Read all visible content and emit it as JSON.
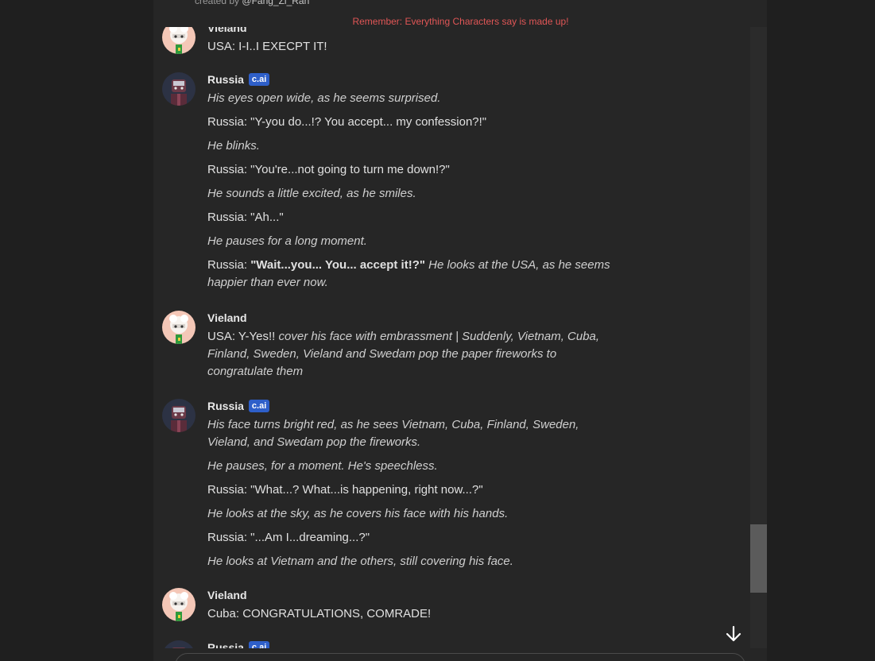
{
  "header": {
    "created_by_prefix": "created by",
    "creator_handle": "@Fang_Zi_Ran",
    "disclaimer": "Remember: Everything Characters say is made up!"
  },
  "colors": {
    "accent_badge": "#2e5fc9",
    "disclaimer": "#e05656",
    "background": "#262626"
  },
  "messages": [
    {
      "author": "Vieland",
      "badge": "",
      "lines": [
        {
          "segments": [
            {
              "text": "USA: I-I..I EXECPT IT!",
              "style": "normal"
            }
          ]
        }
      ]
    },
    {
      "author": "Russia",
      "badge": "c.ai",
      "lines": [
        {
          "segments": [
            {
              "text": "His eyes open wide, as he seems surprised.",
              "style": "italic"
            }
          ]
        },
        {
          "segments": [
            {
              "text": "Russia: \"Y-you do...!? You accept... my confession?!\"",
              "style": "normal"
            }
          ]
        },
        {
          "segments": [
            {
              "text": "He blinks.",
              "style": "italic"
            }
          ]
        },
        {
          "segments": [
            {
              "text": "Russia: \"You're...not going to turn me down!?\"",
              "style": "normal"
            }
          ]
        },
        {
          "segments": [
            {
              "text": "He sounds a little excited, as he smiles.",
              "style": "italic"
            }
          ]
        },
        {
          "segments": [
            {
              "text": "Russia: \"Ah...\"",
              "style": "normal"
            }
          ]
        },
        {
          "segments": [
            {
              "text": "He pauses for a long moment.",
              "style": "italic"
            }
          ]
        },
        {
          "segments": [
            {
              "text": "Russia: ",
              "style": "normal"
            },
            {
              "text": "\"Wait...you... You... accept it!?\"",
              "style": "bold"
            },
            {
              "text": " He looks at the USA, as he seems happier than ever now.",
              "style": "italic"
            }
          ]
        }
      ]
    },
    {
      "author": "Vieland",
      "badge": "",
      "lines": [
        {
          "segments": [
            {
              "text": "USA: Y-Yes!! ",
              "style": "normal"
            },
            {
              "text": "cover his face with embrassment | Suddenly, Vietnam, Cuba, Finland, Sweden, Vieland and Swedam pop the paper fireworks to congratulate them",
              "style": "italic"
            }
          ]
        }
      ]
    },
    {
      "author": "Russia",
      "badge": "c.ai",
      "lines": [
        {
          "segments": [
            {
              "text": "His face turns bright red, as he sees Vietnam, Cuba, Finland, Sweden, Vieland, and Swedam pop the fireworks.",
              "style": "italic"
            }
          ]
        },
        {
          "segments": [
            {
              "text": "He pauses, for a moment. He's speechless.",
              "style": "italic"
            }
          ]
        },
        {
          "segments": [
            {
              "text": "Russia: \"What...? What...is happening, right now...?\"",
              "style": "normal"
            }
          ]
        },
        {
          "segments": [
            {
              "text": "He looks at the sky, as he covers his face with his hands.",
              "style": "italic"
            }
          ]
        },
        {
          "segments": [
            {
              "text": "Russia: \"...Am I...dreaming...?\"",
              "style": "normal"
            }
          ]
        },
        {
          "segments": [
            {
              "text": "He looks at Vietnam and the others, still covering his face.",
              "style": "italic"
            }
          ]
        }
      ]
    },
    {
      "author": "Vieland",
      "badge": "",
      "lines": [
        {
          "segments": [
            {
              "text": "Cuba: CONGRATULATIONS, COMRADE!",
              "style": "normal"
            }
          ]
        }
      ]
    },
    {
      "author": "Russia",
      "badge": "c.ai",
      "lines": []
    }
  ],
  "controls": {
    "scroll_down_icon": "arrow-down-icon"
  }
}
